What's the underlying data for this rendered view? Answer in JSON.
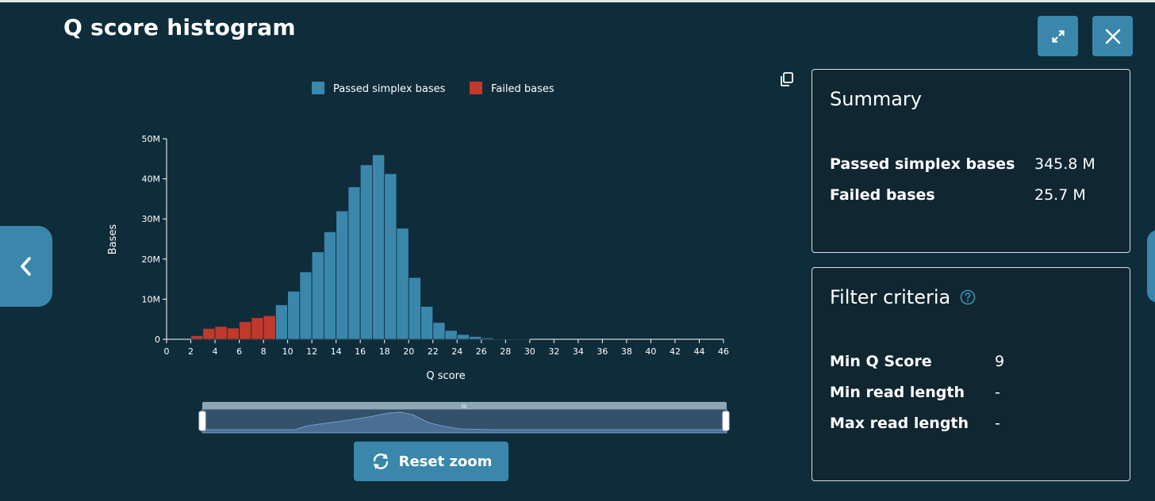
{
  "header": {
    "title": "Q score histogram"
  },
  "colors": {
    "passed": "#3a87ab",
    "failed": "#c0392b",
    "background": "#0f2c3a",
    "panel_border": "#d7e0e5",
    "button": "#3a87ab"
  },
  "icons": {
    "expand": "expand-icon",
    "close": "close-icon",
    "nav_prev": "chevron-left-icon",
    "copy": "copy-icon",
    "help": "help-circle-icon",
    "reset": "refresh-icon"
  },
  "summary": {
    "title": "Summary",
    "rows": [
      {
        "label": "Passed simplex bases",
        "value": "345.8 M"
      },
      {
        "label": "Failed bases",
        "value": "25.7 M"
      }
    ]
  },
  "filter": {
    "title": "Filter criteria",
    "rows": [
      {
        "label": "Min Q Score",
        "value": "9"
      },
      {
        "label": "Min read length",
        "value": "-"
      },
      {
        "label": "Max read length",
        "value": "-"
      }
    ]
  },
  "zoom": {
    "reset_label": "Reset zoom",
    "handle_glyph": "III"
  },
  "chart_data": {
    "type": "bar",
    "xlabel": "Q score",
    "ylabel": "Bases",
    "xlim": [
      0,
      46
    ],
    "ylim": [
      0,
      50000000
    ],
    "x_ticks": [
      "0",
      "2",
      "4",
      "6",
      "8",
      "10",
      "12",
      "14",
      "16",
      "18",
      "20",
      "22",
      "24",
      "26",
      "28",
      "30",
      "32",
      "34",
      "36",
      "38",
      "40",
      "42",
      "44",
      "46"
    ],
    "y_ticks": [
      "0",
      "10M",
      "20M",
      "30M",
      "40M",
      "50M"
    ],
    "legend_position": "top",
    "series": [
      {
        "name": "Passed simplex bases",
        "color": "#3a87ab",
        "bins": [
          {
            "q": 9,
            "value": 8600000
          },
          {
            "q": 10,
            "value": 12000000
          },
          {
            "q": 11,
            "value": 16800000
          },
          {
            "q": 12,
            "value": 21800000
          },
          {
            "q": 13,
            "value": 26800000
          },
          {
            "q": 14,
            "value": 32000000
          },
          {
            "q": 15,
            "value": 38000000
          },
          {
            "q": 16,
            "value": 43500000
          },
          {
            "q": 17,
            "value": 46000000
          },
          {
            "q": 18,
            "value": 41300000
          },
          {
            "q": 19,
            "value": 27700000
          },
          {
            "q": 20,
            "value": 15400000
          },
          {
            "q": 21,
            "value": 8200000
          },
          {
            "q": 22,
            "value": 4200000
          },
          {
            "q": 23,
            "value": 2200000
          },
          {
            "q": 24,
            "value": 1200000
          },
          {
            "q": 25,
            "value": 700000
          },
          {
            "q": 26,
            "value": 350000
          },
          {
            "q": 27,
            "value": 150000
          },
          {
            "q": 28,
            "value": 80000
          },
          {
            "q": 29,
            "value": 40000
          }
        ]
      },
      {
        "name": "Failed bases",
        "color": "#c0392b",
        "bins": [
          {
            "q": 2,
            "value": 900000
          },
          {
            "q": 3,
            "value": 2700000
          },
          {
            "q": 4,
            "value": 3200000
          },
          {
            "q": 5,
            "value": 2800000
          },
          {
            "q": 6,
            "value": 4400000
          },
          {
            "q": 7,
            "value": 5400000
          },
          {
            "q": 8,
            "value": 5900000
          }
        ]
      }
    ]
  }
}
